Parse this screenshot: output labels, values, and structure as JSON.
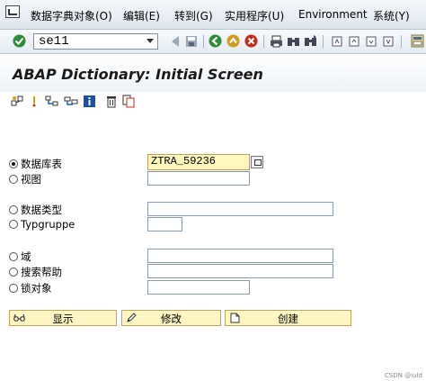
{
  "menu": {
    "items": [
      "数据字典对象(O)",
      "编辑(E)",
      "转到(G)",
      "实用程序(U)",
      "Environment",
      "系统(Y)"
    ]
  },
  "toolbar": {
    "command_value": "se11"
  },
  "page": {
    "title": "ABAP Dictionary: Initial Screen"
  },
  "form": {
    "options": [
      {
        "label": "数据库表",
        "value": "ZTRA_59236",
        "selected": true
      },
      {
        "label": "视图",
        "value": "",
        "selected": false
      },
      {
        "label": "数据类型",
        "value": "",
        "selected": false
      },
      {
        "label": "Typgruppe",
        "value": "",
        "selected": false
      },
      {
        "label": "域",
        "value": "",
        "selected": false
      },
      {
        "label": "搜索帮助",
        "value": "",
        "selected": false
      },
      {
        "label": "锁对象",
        "value": "",
        "selected": false
      }
    ]
  },
  "actions": {
    "display": "显示",
    "change": "修改",
    "create": "创建"
  },
  "footer": {
    "watermark": "CSDN @iuld"
  }
}
